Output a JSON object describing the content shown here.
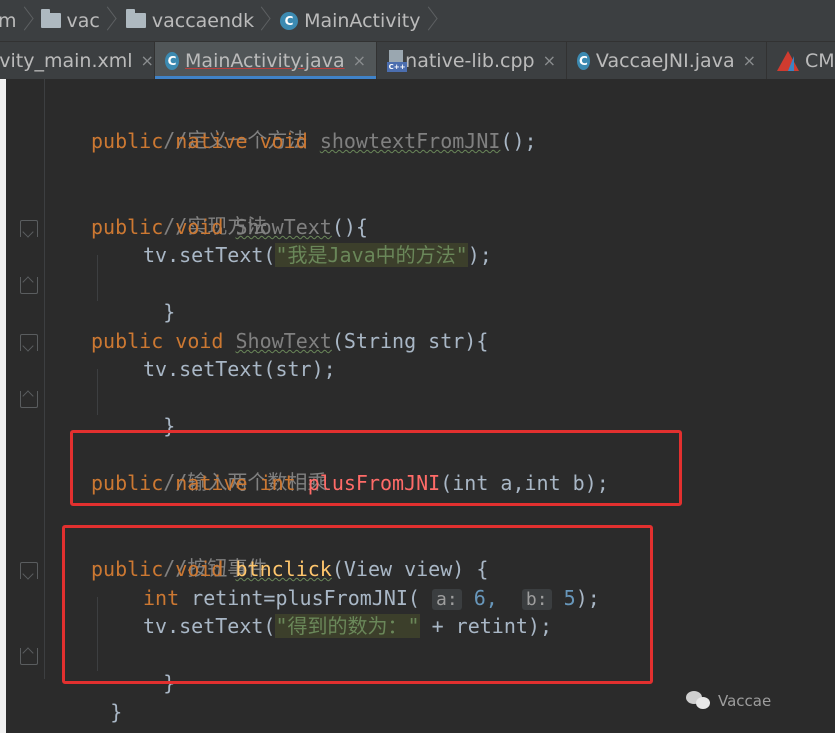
{
  "breadcrumb": {
    "items": [
      {
        "label": "m",
        "icon": "none"
      },
      {
        "label": "vac",
        "icon": "folder-icon"
      },
      {
        "label": "vaccaendk",
        "icon": "folder-icon"
      },
      {
        "label": "MainActivity",
        "icon": "class-icon"
      }
    ],
    "class_icon_letter": "C"
  },
  "tabs": [
    {
      "label": "ivity_main.xml",
      "icon": "none",
      "active": false
    },
    {
      "label": "MainActivity.java",
      "icon": "class-icon",
      "active": true
    },
    {
      "label": "native-lib.cpp",
      "icon": "cpp-file-icon",
      "active": false
    },
    {
      "label": "VaccaeJNI.java",
      "icon": "class-icon",
      "active": false
    },
    {
      "label": "CM",
      "icon": "cmake-icon",
      "active": false
    }
  ],
  "tab_close_glyph": "×",
  "cpp_badge": "C++",
  "code": {
    "comment1": "//定义一个方法",
    "comment2": "//实现方法",
    "comment3": "//输入两个数相乘",
    "comment4": "//按钮事件",
    "kw_public": "public",
    "kw_native": "native",
    "kw_void": "void",
    "kw_int": "int",
    "m_showtextFromJNI": "showtextFromJNI",
    "m_ShowText": "ShowText",
    "m_plusFromJNI": "plusFromJNI",
    "m_btnclick": "btnclick",
    "empty_parens_semi": "();",
    "parens_brace": "(){",
    "open_brace": "{",
    "close_brace": "}",
    "tv_settext": "tv.setText(",
    "str_java": "\"我是Java中的方法\"",
    "close_paren_semi": ");",
    "string_param": "(String str){",
    "str_arg": "str",
    "plus_params": "(int a,int b);",
    "view_param": "(View view) {",
    "retint_assign": "retint=plusFromJNI(",
    "hint_a": "a:",
    "val_a": "6,",
    "hint_b": "b:",
    "val_b": "5",
    "str_result": "\"得到的数为：\"",
    "plus_retint": " + retint",
    "class_close": "}"
  },
  "watermark": {
    "text": "Vaccae",
    "icon": "wechat-icon"
  },
  "colors": {
    "editor_bg": "#2b2b2b",
    "keyword": "#cc7832",
    "method": "#ffc66d",
    "comment": "#808080",
    "string": "#6a8759",
    "highlight_box": "#e2302f",
    "tab_active_indicator": "#4083c9"
  }
}
